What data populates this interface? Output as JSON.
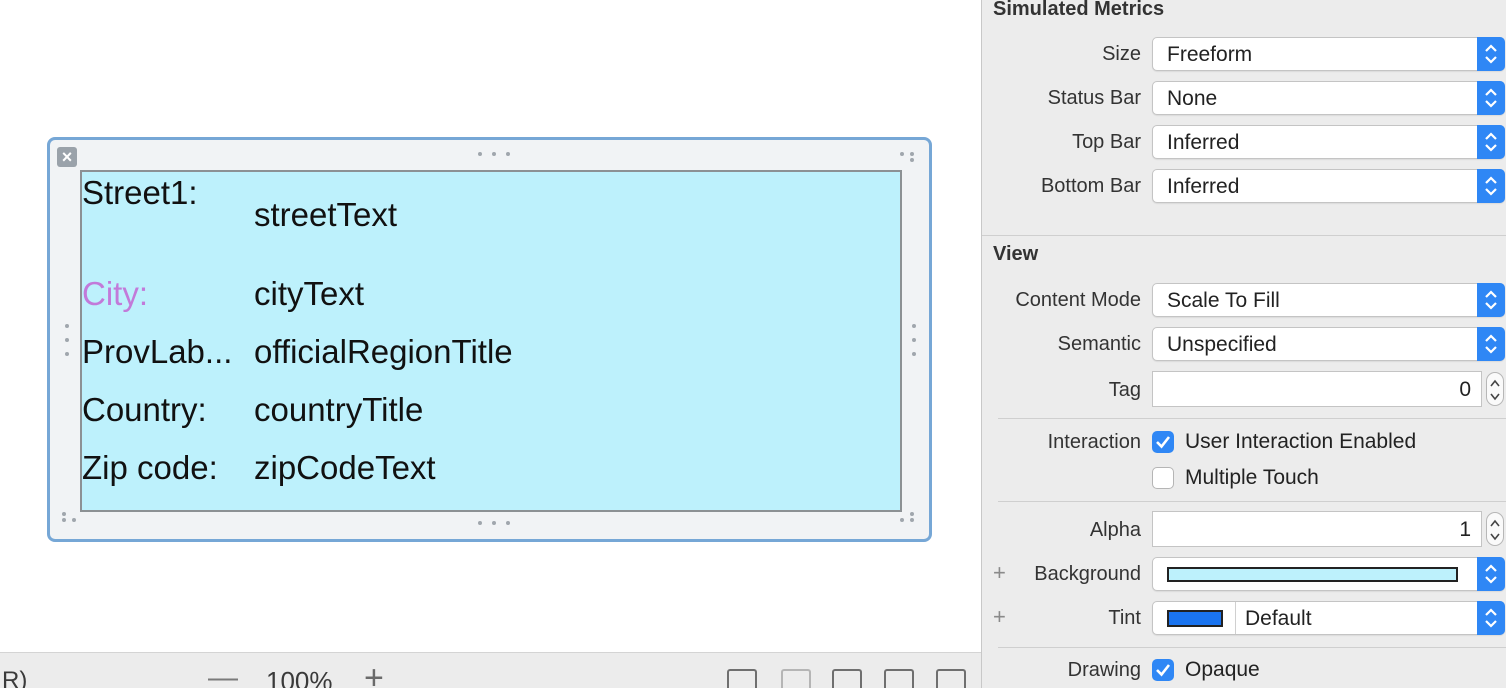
{
  "canvas": {
    "labels": {
      "street_label": "Street1:",
      "street_text": "streetText",
      "city_label": "City:",
      "city_text": "cityText",
      "prov_label": "ProvLab...",
      "prov_text": "officialRegionTitle",
      "country_label": "Country:",
      "country_text": "countryTitle",
      "zip_label": "Zip code:",
      "zip_text": "zipCodeText"
    },
    "background_color": "#bdf1fc",
    "city_label_color": "#c27ad9"
  },
  "bottom_bar": {
    "left_fragment": "R)",
    "zoom_out": "—",
    "zoom_level": "100%",
    "zoom_in": "+"
  },
  "inspector": {
    "simulated_metrics": {
      "title": "Simulated Metrics",
      "size_label": "Size",
      "size_value": "Freeform",
      "status_bar_label": "Status Bar",
      "status_bar_value": "None",
      "top_bar_label": "Top Bar",
      "top_bar_value": "Inferred",
      "bottom_bar_label": "Bottom Bar",
      "bottom_bar_value": "Inferred"
    },
    "view": {
      "title": "View",
      "content_mode_label": "Content Mode",
      "content_mode_value": "Scale To Fill",
      "semantic_label": "Semantic",
      "semantic_value": "Unspecified",
      "tag_label": "Tag",
      "tag_value": "0",
      "interaction_label": "Interaction",
      "user_interaction_label": "User Interaction Enabled",
      "user_interaction_checked": true,
      "multiple_touch_label": "Multiple Touch",
      "multiple_touch_checked": false,
      "alpha_label": "Alpha",
      "alpha_value": "1",
      "background_label": "Background",
      "background_color": "#bdf1fc",
      "tint_label": "Tint",
      "tint_value": "Default",
      "tint_color": "#1a74f0",
      "drawing_label": "Drawing",
      "opaque_label": "Opaque",
      "opaque_checked": true
    },
    "accent_color": "#2f87f5"
  }
}
